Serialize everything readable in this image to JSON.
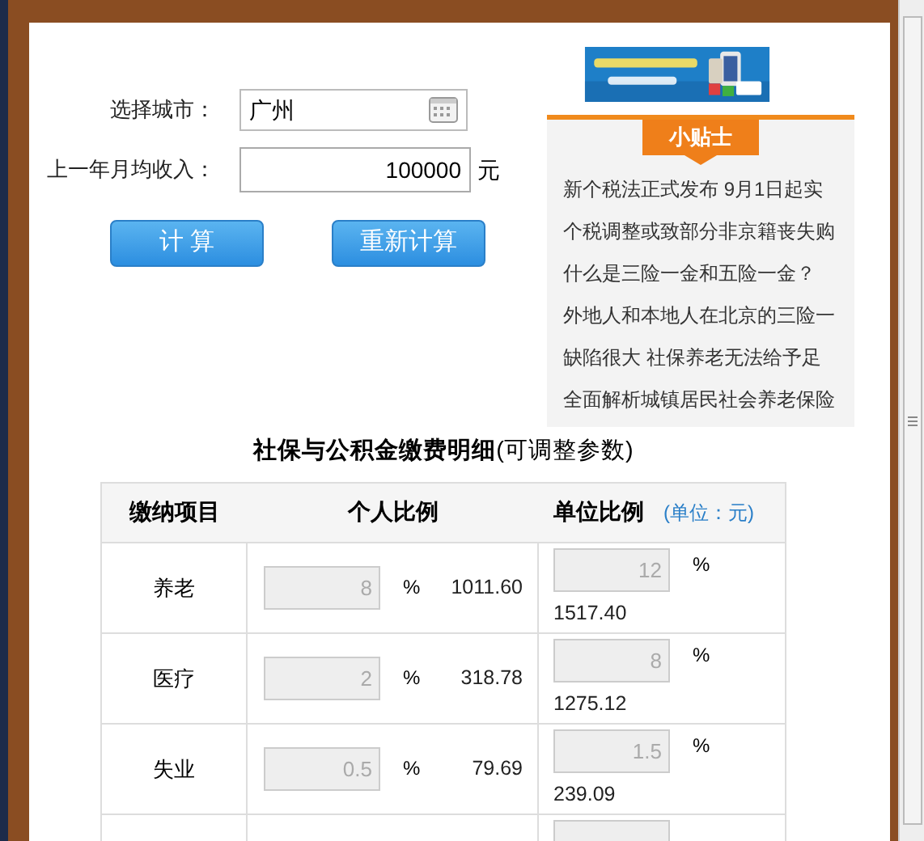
{
  "form": {
    "city_label": "选择城市：",
    "city_value": "广州",
    "income_label": "上一年月均收入：",
    "income_value": "100000",
    "income_unit": "元"
  },
  "buttons": [
    {
      "label": "计 算"
    },
    {
      "label": "重新计算"
    }
  ],
  "tips": {
    "title": "小贴士",
    "items": [
      "新个税法正式发布  9月1日起实",
      "个税调整或致部分非京籍丧失购",
      "什么是三险一金和五险一金？",
      "外地人和本地人在北京的三险一",
      "缺陷很大  社保养老无法给予足",
      "全面解析城镇居民社会养老保险"
    ]
  },
  "table": {
    "title": "**社保与公积金缴费明细**(可调整参数)",
    "columns": [
      "缴纳项目",
      "个人比例",
      "单位比例"
    ],
    "unit_note": "(单位：元)",
    "rows": [
      {
        "item": "养老",
        "personal_rate": "8",
        "personal_amount": "1011.60",
        "employer_rate": "12",
        "employer_amount": "1517.40"
      },
      {
        "item": "医疗",
        "personal_rate": "2",
        "personal_amount": "318.78",
        "employer_rate": "8",
        "employer_amount": "1275.12"
      },
      {
        "item": "失业",
        "personal_rate": "0.5",
        "personal_amount": "79.69",
        "employer_rate": "1.5",
        "employer_amount": "239.09"
      }
    ],
    "percent_sign": "%"
  }
}
